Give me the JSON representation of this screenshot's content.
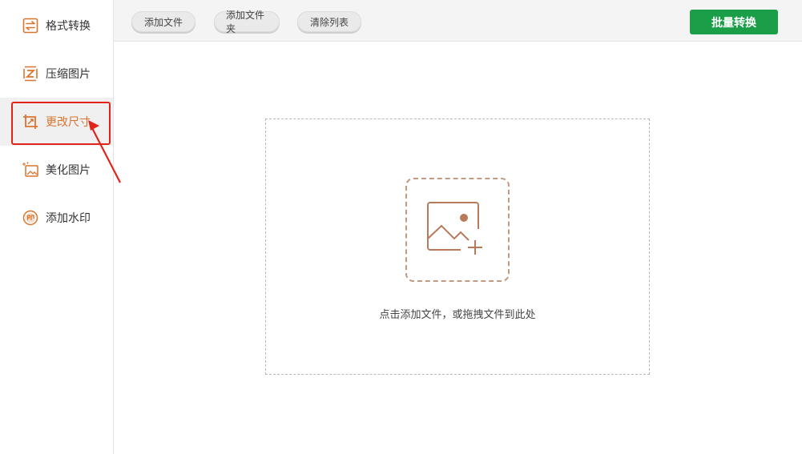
{
  "sidebar": {
    "items": [
      {
        "label": "格式转换",
        "icon": "format-convert-icon"
      },
      {
        "label": "压缩图片",
        "icon": "compress-icon"
      },
      {
        "label": "更改尺寸",
        "icon": "resize-crop-icon",
        "active": true
      },
      {
        "label": "美化图片",
        "icon": "beautify-icon"
      },
      {
        "label": "添加水印",
        "icon": "watermark-seal-icon"
      }
    ]
  },
  "toolbar": {
    "add_file": "添加文件",
    "add_folder": "添加文件夹",
    "clear_list": "清除列表",
    "batch_convert": "批量转换"
  },
  "drop_zone": {
    "hint": "点击添加文件，或拖拽文件到此处",
    "icon": "add-image-icon"
  },
  "colors": {
    "accent_orange": "#d9742f",
    "batch_green": "#1a9e48",
    "annotation_red": "#e0241c"
  }
}
